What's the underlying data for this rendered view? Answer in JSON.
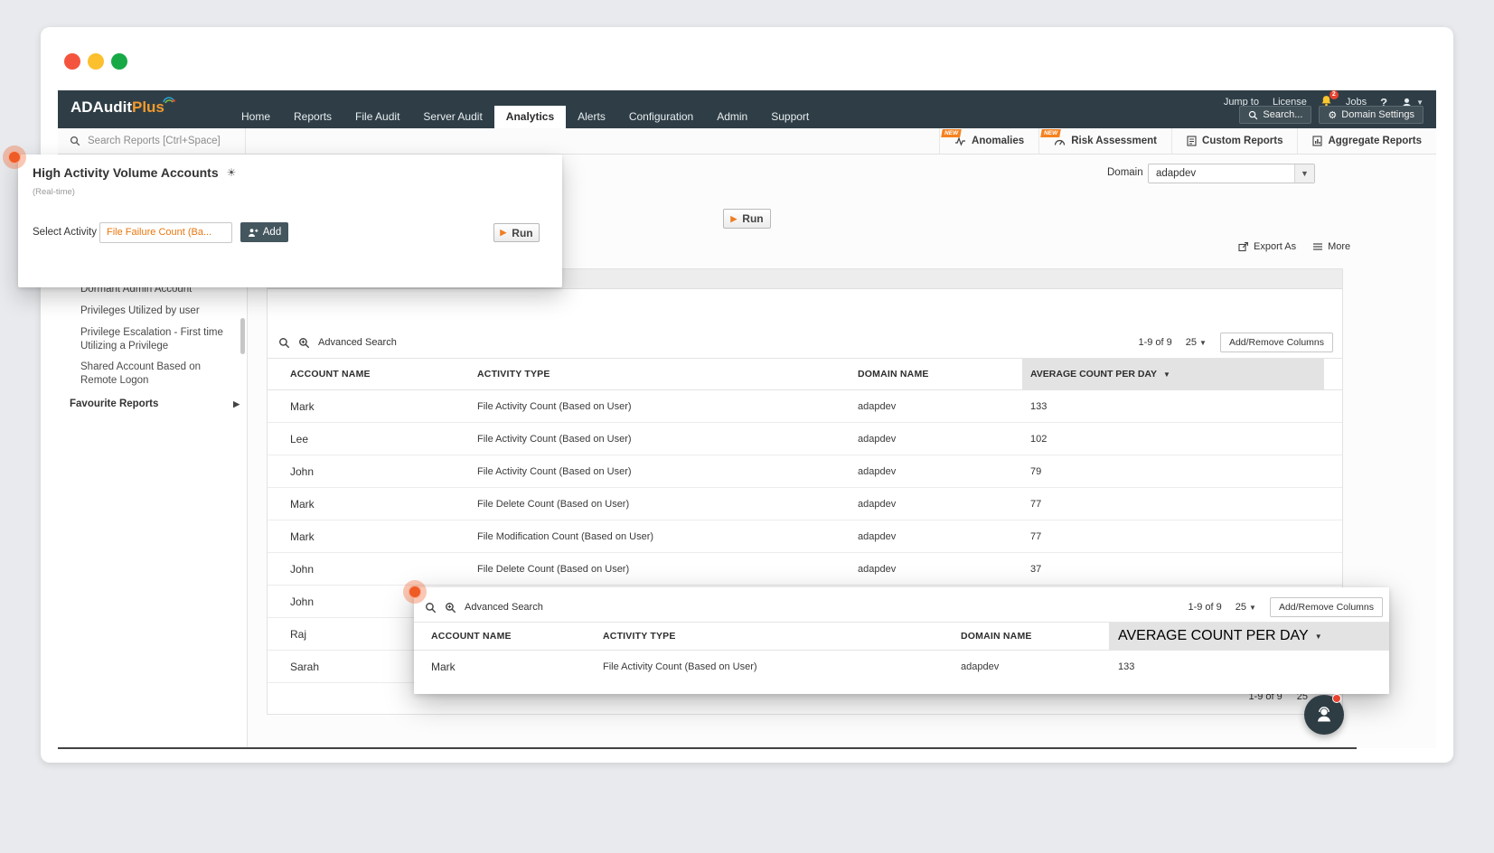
{
  "colors": {
    "accent_orange": "#ee7d23",
    "navbar_bg": "#2f3e46",
    "new_badge": "#f6821f",
    "avg_header_bg": "#e3e3e3"
  },
  "navbar": {
    "logo_part1": "ADAudit",
    "logo_part2": "Plus",
    "tabs": [
      {
        "label": "Home"
      },
      {
        "label": "Reports"
      },
      {
        "label": "File Audit"
      },
      {
        "label": "Server Audit"
      },
      {
        "label": "Analytics"
      },
      {
        "label": "Alerts"
      },
      {
        "label": "Configuration"
      },
      {
        "label": "Admin"
      },
      {
        "label": "Support"
      }
    ],
    "jump_to": "Jump to",
    "license": "License",
    "bell_badge": "2",
    "jobs": "Jobs",
    "help": "?",
    "search_button": "Search...",
    "domain_settings_button": "Domain Settings"
  },
  "reportsbar": {
    "search_placeholder": "Search Reports [Ctrl+Space]",
    "new_label": "NEW",
    "items": [
      {
        "label": "Anomalies"
      },
      {
        "label": "Risk Assessment"
      },
      {
        "label": "Custom Reports"
      },
      {
        "label": "Aggregate Reports"
      }
    ]
  },
  "popup": {
    "title": "High Activity Volume Accounts",
    "subtitle": "(Real-time)",
    "select_activity_label": "Select Activity",
    "activity_value": "File Failure Count (Ba...",
    "add_button": "Add",
    "run_button": "Run"
  },
  "content": {
    "domain_label": "Domain",
    "domain_value": "adapdev",
    "run_button": "Run",
    "export_as": "Export As",
    "more": "More"
  },
  "sidebar": {
    "items": [
      {
        "label": "Dormant Admin Account"
      },
      {
        "label": "Privileges Utilized by user"
      },
      {
        "label": "Privilege Escalation - First time Utilizing a Privilege"
      },
      {
        "label": "Shared Account Based on Remote Logon"
      }
    ],
    "favourite_reports": "Favourite Reports"
  },
  "table": {
    "advanced_search": "Advanced Search",
    "pagination": "1-9 of 9",
    "page_size": "25",
    "add_remove_columns": "Add/Remove Columns",
    "columns": [
      "ACCOUNT NAME",
      "ACTIVITY TYPE",
      "DOMAIN NAME",
      "AVERAGE COUNT PER DAY"
    ],
    "rows": [
      {
        "account": "Mark",
        "activity": "File Activity Count (Based on User)",
        "domain": "adapdev",
        "count": "133"
      },
      {
        "account": "Lee",
        "activity": "File Activity Count (Based on User)",
        "domain": "adapdev",
        "count": "102"
      },
      {
        "account": "John",
        "activity": "File Activity Count (Based on User)",
        "domain": "adapdev",
        "count": "79"
      },
      {
        "account": "Mark",
        "activity": "File Delete Count (Based on User)",
        "domain": "adapdev",
        "count": "77"
      },
      {
        "account": "Mark",
        "activity": "File Modification Count (Based on User)",
        "domain": "adapdev",
        "count": "77"
      },
      {
        "account": "John",
        "activity": "File Delete Count (Based on User)",
        "domain": "adapdev",
        "count": "37"
      },
      {
        "account": "John",
        "activity": "",
        "domain": "",
        "count": ""
      },
      {
        "account": "Raj",
        "activity": "",
        "domain": "",
        "count": ""
      },
      {
        "account": "Sarah",
        "activity": "",
        "domain": "",
        "count": ""
      }
    ],
    "footer_pagination": "1-9 of 9",
    "footer_page_size": "25"
  },
  "overlay_table": {
    "advanced_search": "Advanced Search",
    "pagination": "1-9 of 9",
    "page_size": "25",
    "add_remove_columns": "Add/Remove Columns",
    "columns": [
      "ACCOUNT NAME",
      "ACTIVITY TYPE",
      "DOMAIN NAME",
      "AVERAGE COUNT PER DAY"
    ],
    "row": {
      "account": "Mark",
      "activity": "File Activity Count (Based on User)",
      "domain": "adapdev",
      "count": "133"
    }
  }
}
